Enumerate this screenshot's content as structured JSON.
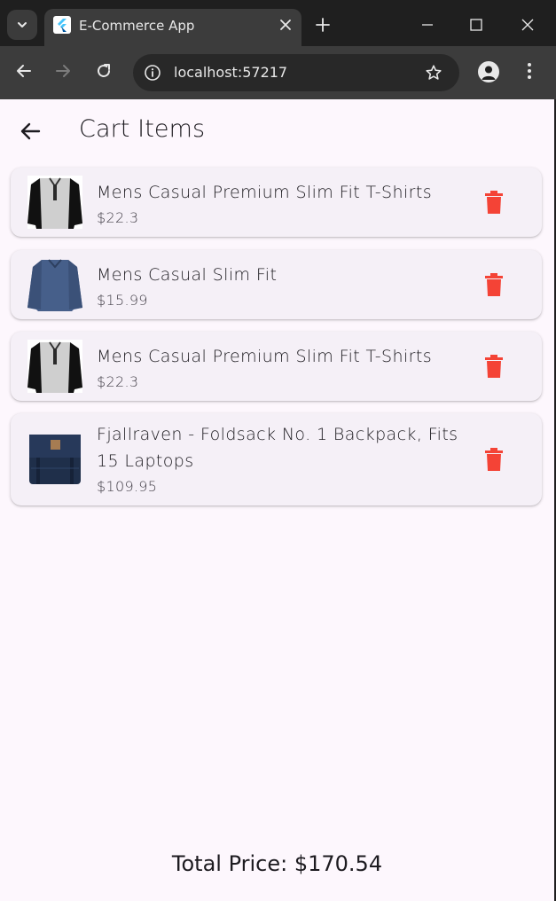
{
  "browser": {
    "tab_title": "E-Commerce App",
    "url": "localhost:57217",
    "icons": [
      "tab-search-icon",
      "flutter-favicon",
      "close-icon",
      "plus-icon",
      "minimize-icon",
      "maximize-icon",
      "close-window-icon",
      "back-icon",
      "forward-icon",
      "reload-icon",
      "info-icon",
      "star-icon",
      "profile-icon",
      "more-icon"
    ]
  },
  "app": {
    "title": "Cart Items",
    "accent": "#f44336",
    "background": "#fdf7fd",
    "card_background": "#f5f0f7"
  },
  "cart": {
    "items": [
      {
        "name": "Mens Casual Premium Slim Fit T-Shirts",
        "price": "$22.3",
        "image": "tshirt-gray-black-sleeves"
      },
      {
        "name": "Mens Casual Slim Fit",
        "price": "$15.99",
        "image": "shirt-blue-long-sleeve"
      },
      {
        "name": "Mens Casual Premium Slim Fit T-Shirts",
        "price": "$22.3",
        "image": "tshirt-gray-black-sleeves"
      },
      {
        "name": "Fjallraven - Foldsack No. 1 Backpack, Fits 15 Laptops",
        "price": "$109.95",
        "image": "backpack-navy"
      }
    ]
  },
  "footer": {
    "total_label": "Total Price: $170.54"
  }
}
